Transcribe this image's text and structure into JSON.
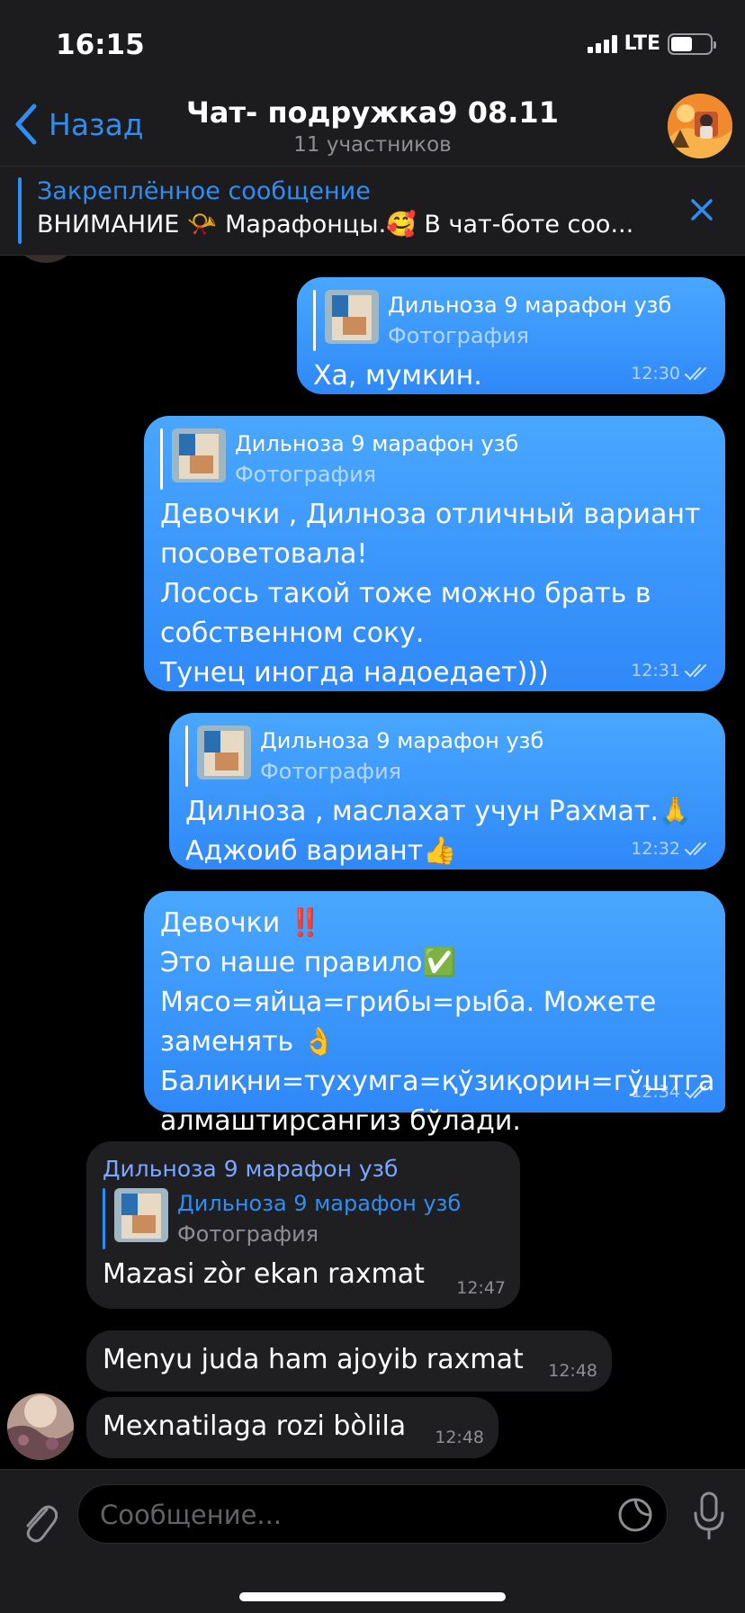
{
  "status_bar": {
    "time": "16:15",
    "network": "LTE"
  },
  "header": {
    "back_label": "Назад",
    "title": "Чат- подружка9 08.11",
    "subtitle": "11 участников"
  },
  "pinned": {
    "title": "Закреплённое сообщение",
    "text": "ВНИМАНИЕ 📯 Марафонцы.🥰 В чат-боте соо..."
  },
  "messages": [
    {
      "reply_name": "Дильноза 9 марафон узб",
      "reply_type": "Фотография",
      "text": "Ха, мумкин.",
      "time": "12:30"
    },
    {
      "reply_name": "Дильноза 9 марафон узб",
      "reply_type": "Фотография",
      "text": "Девочки , Дилноза отличный вариант\nпосоветовала!\nЛосось такой тоже можно брать в\nсобственном соку.\nТунец иногда надоедает)))",
      "time": "12:31"
    },
    {
      "reply_name": "Дильноза 9 марафон узб",
      "reply_type": "Фотография",
      "text": "Дилноза , маслахат учун Рахмат.🙏\nАджоиб вариант👍",
      "time": "12:32"
    },
    {
      "text": "Девочки ‼️\nЭто наше правило✅\nМясо=яйца=грибы=рыба. Можете\nзаменять 👌\nБалиқни=тухумга=қўзиқорин=гўштга\nалмаштирсангиз бўлади.",
      "time": "12:34"
    },
    {
      "sender": "Дильноза 9 марафон узб",
      "reply_name": "Дильноза 9 марафон узб",
      "reply_type": "Фотография",
      "text": "Mazasi zòr ekan raxmat",
      "time": "12:47"
    },
    {
      "text": "Menyu juda ham ajoyib raxmat",
      "time": "12:48"
    },
    {
      "text": "Mexnatilaga rozi bòlila",
      "time": "12:48"
    }
  ],
  "input": {
    "placeholder": "Сообщение..."
  },
  "colors": {
    "accent": "#2f8ef5",
    "outgoing_bubble": "#3a95fb",
    "incoming_bubble": "#1f1f22"
  }
}
